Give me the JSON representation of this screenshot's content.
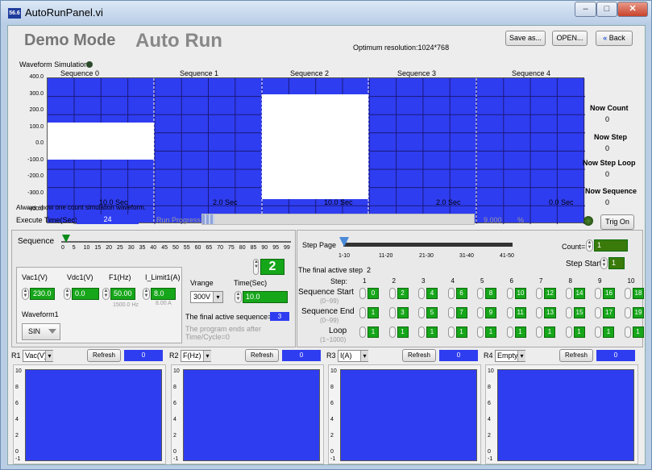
{
  "window": {
    "title": "AutoRunPanel.vi",
    "icon": "56.6"
  },
  "header": {
    "mode": "Demo Mode",
    "title": "Auto Run",
    "resolution": "Optimum resolution:1024*768",
    "save_label": "Save as...",
    "open_label": "OPEN...",
    "back_label": "Back"
  },
  "waveform": {
    "label": "Waveform Simulation",
    "note": "Always show one count simulation waveform.",
    "sequences": [
      {
        "label": "Sequence",
        "num": "0",
        "time": "10.0",
        "unit": "Sec"
      },
      {
        "label": "Sequence",
        "num": "1",
        "time": "2.0",
        "unit": "Sec"
      },
      {
        "label": "Sequence",
        "num": "2",
        "time": "10.0",
        "unit": "Sec"
      },
      {
        "label": "Sequence",
        "num": "3",
        "time": "2.0",
        "unit": "Sec"
      },
      {
        "label": "Sequence",
        "num": "4",
        "time": "0.0",
        "unit": "Sec"
      }
    ],
    "yticks": [
      "400.0",
      "300.0",
      "200.0",
      "100.0",
      "0.0",
      "-100.0",
      "-200.0",
      "-300.0",
      "-400.0"
    ]
  },
  "status": {
    "now_count_label": "Now Count",
    "now_count": "0",
    "now_step_label": "Now Step",
    "now_step": "0",
    "now_step_loop_label": "Now Step Loop",
    "now_step_loop": "0",
    "now_seq_label": "Now Sequence",
    "now_seq": "0"
  },
  "exec": {
    "label": "Execute Time(Sec)",
    "value": "24",
    "progress_label": "Run Progress",
    "progress_value": "9.000",
    "progress_unit": "%",
    "trig_label": "Trig On",
    "progress_fraction": 0.045
  },
  "sequence": {
    "label": "Sequence",
    "ticks": [
      "0",
      "5",
      "10",
      "15",
      "20",
      "25",
      "30",
      "35",
      "40",
      "45",
      "50",
      "55",
      "60",
      "65",
      "70",
      "75",
      "80",
      "85",
      "90",
      "95",
      "99"
    ],
    "value": "2",
    "vac_label": "Vac1(V)",
    "vac": "230.0",
    "vdc_label": "Vdc1(V)",
    "vdc": "0.0",
    "f_label": "F1(Hz)",
    "f": "50.00",
    "f_hint": "1500.0 Hz",
    "ilim_label": "I_Limit1(A)",
    "ilim": "8.0",
    "ilim_hint": "8.00  A",
    "vrange_label": "Vrange",
    "vrange": "300V",
    "time_label": "Time(Sec)",
    "time": "10.0",
    "waveform_label": "Waveform1",
    "waveform": "SIN",
    "final_label": "The final active sequence=",
    "final": "3",
    "ends_note_1": "The program ends after",
    "ends_note_2": "Time/Cycle=0"
  },
  "steps": {
    "page_label": "Step Page",
    "page_ticks": [
      "1-10",
      "11-20",
      "21-30",
      "31-40",
      "41-50"
    ],
    "count_label": "Count=",
    "count": "1",
    "start_label": "Step Start",
    "start": "1",
    "final_label": "The final active step",
    "final": "2",
    "step_label": "Step:",
    "nums": [
      "1",
      "2",
      "3",
      "4",
      "5",
      "6",
      "7",
      "8",
      "9",
      "10"
    ],
    "seq_start_label": "Sequence Start",
    "seq_start_hint": "(0~99)",
    "seq_start": [
      "0",
      "2",
      "4",
      "6",
      "8",
      "10",
      "12",
      "14",
      "16",
      "18"
    ],
    "seq_end_label": "Sequence End",
    "seq_end_hint": "(0~99)",
    "seq_end": [
      "1",
      "3",
      "5",
      "7",
      "9",
      "11",
      "13",
      "15",
      "17",
      "19"
    ],
    "loop_label": "Loop",
    "loop_hint": "(1~1000)",
    "loop": [
      "1",
      "1",
      "1",
      "1",
      "1",
      "1",
      "1",
      "1",
      "1",
      "1"
    ]
  },
  "readouts": [
    {
      "id": "R1",
      "sel": "Vac(V)",
      "refresh": "Refresh",
      "value": "0"
    },
    {
      "id": "R2",
      "sel": "F(Hz)",
      "refresh": "Refresh",
      "value": "0"
    },
    {
      "id": "R3",
      "sel": "I(A)",
      "refresh": "Refresh",
      "value": "0"
    },
    {
      "id": "R4",
      "sel": "Empty",
      "refresh": "Refresh",
      "value": "0"
    }
  ],
  "small_yticks": [
    "10",
    "8",
    "6",
    "4",
    "2",
    "0",
    "-1"
  ]
}
